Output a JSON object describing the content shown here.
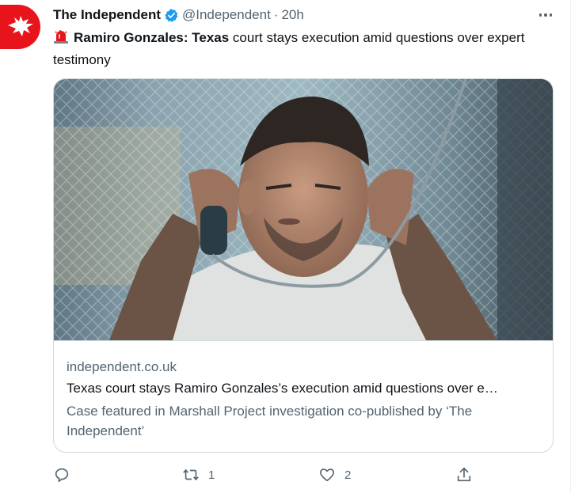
{
  "tweet": {
    "display_name": "The Independent",
    "handle": "@Independent",
    "separator": "·",
    "time": "20h",
    "text_bold": "Ramiro Gonzales: Texas",
    "text_rest": " court stays execution amid questions over expert testimony"
  },
  "card": {
    "domain": "independent.co.uk",
    "title": "Texas court stays Ramiro Gonzales’s execution amid questions over e…",
    "description": "Case featured in Marshall Project investigation co-published by ‘The Independent’"
  },
  "actions": {
    "retweets": "1",
    "likes": "2"
  },
  "colors": {
    "brand_red": "#e8141c",
    "verified_blue": "#1d9bf0",
    "muted_text": "#536471",
    "border": "#cfd9de"
  },
  "icons": {
    "avatar": "eagle-logo-icon",
    "verified": "verified-badge-icon",
    "more": "more-options-icon",
    "siren": "siren-emoji-icon",
    "reply": "reply-icon",
    "retweet": "retweet-icon",
    "like": "heart-icon",
    "share": "share-icon"
  }
}
